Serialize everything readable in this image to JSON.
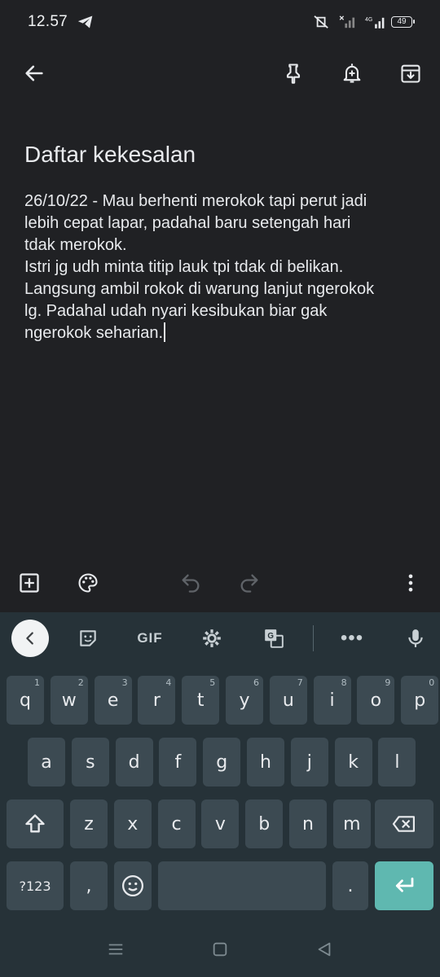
{
  "status_bar": {
    "time": "12.57",
    "network": "4G",
    "battery": "49"
  },
  "toolbar": {
    "back": "arrow-back-icon",
    "pin": "pin-icon",
    "reminder": "bell-plus-icon",
    "archive": "archive-icon"
  },
  "note": {
    "title": "Daftar kekesalan",
    "body": "26/10/22 - Mau berhenti merokok tapi perut jadi\nlebih cepat lapar, padahal baru setengah hari\ntdak merokok.\nIstri jg udh minta titip lauk tpi tdak di belikan.\nLangsung ambil rokok di warung lanjut ngerokok\nlg. Padahal udah nyari kesibukan biar gak\nngerokok seharian."
  },
  "editor_bar": {
    "add": "add-box-icon",
    "palette": "palette-icon",
    "undo": "undo-icon",
    "redo": "redo-icon",
    "more": "more-vert-icon"
  },
  "keyboard": {
    "toolbar": {
      "gif_label": "GIF",
      "more_label": "•••"
    },
    "row1": [
      {
        "key": "q",
        "hint": "1"
      },
      {
        "key": "w",
        "hint": "2"
      },
      {
        "key": "e",
        "hint": "3"
      },
      {
        "key": "r",
        "hint": "4"
      },
      {
        "key": "t",
        "hint": "5"
      },
      {
        "key": "y",
        "hint": "6"
      },
      {
        "key": "u",
        "hint": "7"
      },
      {
        "key": "i",
        "hint": "8"
      },
      {
        "key": "o",
        "hint": "9"
      },
      {
        "key": "p",
        "hint": "0"
      }
    ],
    "row2": [
      "a",
      "s",
      "d",
      "f",
      "g",
      "h",
      "j",
      "k",
      "l"
    ],
    "row3": [
      "z",
      "x",
      "c",
      "v",
      "b",
      "n",
      "m"
    ],
    "row4": {
      "symbols": "?123",
      "comma": ",",
      "period": "."
    }
  },
  "colors": {
    "background": "#202124",
    "keyboard_bg": "#263238",
    "key_bg": "#3c4a52",
    "enter_key": "#5fb8b0"
  }
}
